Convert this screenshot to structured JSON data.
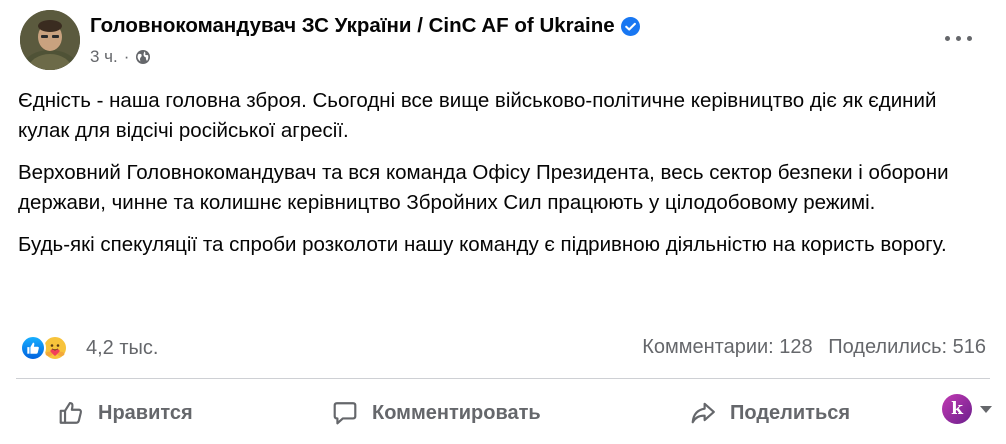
{
  "post": {
    "author": "Головнокомандувач ЗС України / CinC AF of Ukraine",
    "verified": true,
    "time": "3 ч.",
    "separator": "·",
    "privacy_icon": "globe-icon",
    "paragraphs": [
      "Єдність - наша головна зброя. Сьогодні все вище військово-політичне керівництво діє як єдиний кулак для відсічі російської агресії.",
      "Верховний Головнокомандувач та вся команда Офісу Президента, весь сектор безпеки і оборони держави, чинне та колишнє керівництво Збройних Сил працюють у цілодобовому режимі.",
      "Будь-які спекуляції та спроби розколоти нашу команду є підривною діяльністю на користь ворогу."
    ]
  },
  "reactions": {
    "icons": [
      "like-icon",
      "care-icon"
    ],
    "count": "4,2 тыс."
  },
  "stats": {
    "comments": "Комментарии: 128",
    "shares": "Поделились: 516"
  },
  "actions": {
    "like_label": "Нравится",
    "comment_label": "Комментировать",
    "share_label": "Поделиться"
  },
  "profile_switch": {
    "avatar_letter": "k"
  },
  "colors": {
    "primary_text": "#050505",
    "secondary_text": "#65676b",
    "accent_blue": "#1877f2",
    "divider": "#ced0d4"
  }
}
